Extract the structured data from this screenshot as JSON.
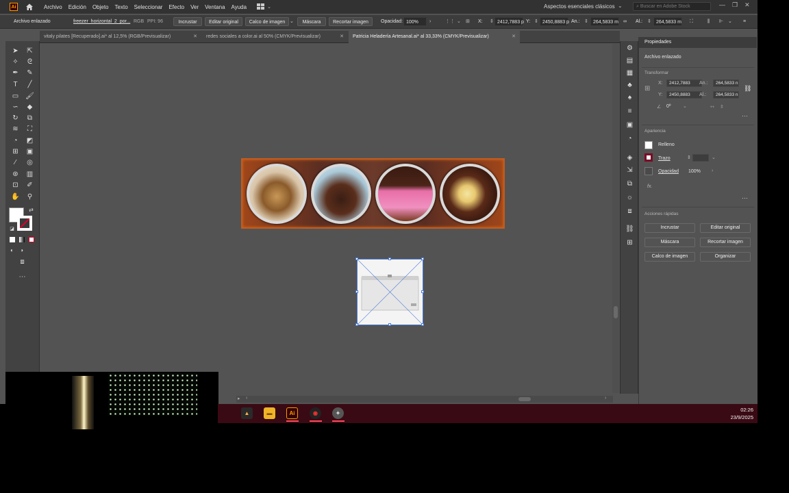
{
  "menu": {
    "logo": "Ai",
    "items": [
      "Archivo",
      "Edición",
      "Objeto",
      "Texto",
      "Seleccionar",
      "Efecto",
      "Ver",
      "Ventana",
      "Ayuda"
    ],
    "workspace": "Aspectos esenciales clásicos",
    "stock_search_placeholder": "Buscar en Adobe Stock"
  },
  "control": {
    "context": "Archivo enlazado",
    "file_name": "freezer_horizontal_2_por...",
    "color_mode": "RGB",
    "ppi": "PPI: 96",
    "embed": "Incrustar",
    "edit_original": "Editar original",
    "image_trace": "Calco de imagen",
    "mask": "Máscara",
    "crop": "Recortar imagen",
    "opacity_label": "Opacidad:",
    "opacity": "100%",
    "x_label": "X:",
    "x": "2412,7883 p",
    "y_label": "Y:",
    "y": "2450,8883 p",
    "w_label": "An.:",
    "w": "264,5833 m",
    "h_label": "Al.:",
    "h": "264,5833 m"
  },
  "tabs": [
    {
      "label": "vitaly pilates [Recuperado].ai* al 12,5% (RGB/Previsualizar)",
      "active": false
    },
    {
      "label": "redes sociales a color.ai al 50% (CMYK/Previsualizar)",
      "active": false
    },
    {
      "label": "Patricia Heladería Artesanal.ai* al 33,33% (CMYK/Previsualizar)",
      "active": true
    }
  ],
  "properties": {
    "tab": "Propiedades",
    "object_type": "Archivo enlazado",
    "transform_head": "Transformar",
    "x_label": "X:",
    "x": "2412,7883",
    "y_label": "Y:",
    "y": "2450,8883",
    "w_label": "An.:",
    "w": "264,5833 n",
    "h_label": "Al.:",
    "h": "264,5833 n",
    "angle": "0º",
    "appearance_head": "Apariencia",
    "fill_label": "Relleno",
    "stroke_label": "Trazo",
    "opacity_label": "Opacidad",
    "opacity": "100%",
    "fx": "fx.",
    "quick_actions_head": "Acciones rápidas",
    "qa_embed": "Incrustar",
    "qa_edit_original": "Editar original",
    "qa_mask": "Máscara",
    "qa_crop": "Recortar imagen",
    "qa_trace": "Calco de imagen",
    "qa_arrange": "Organizar"
  },
  "taskbar": {
    "time": "02:26",
    "date": "23/9/2025",
    "apps": [
      "vlc-icon",
      "explorer-icon",
      "illustrator-icon",
      "chrome-icon",
      "app-icon"
    ]
  },
  "colors": {
    "accent": "#ff9a00",
    "selection": "#4a7bd6",
    "banner_border": "#c35b1e",
    "taskbar": "#3a0a14"
  }
}
